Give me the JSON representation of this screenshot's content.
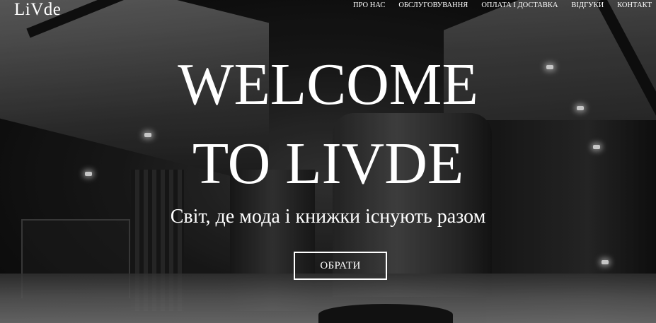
{
  "header": {
    "logo": "LiVde",
    "nav": [
      {
        "label": "ПРО НАС"
      },
      {
        "label": "ОБСЛУГОВУВАННЯ"
      },
      {
        "label": "ОПЛАТА І ДОСТАВКА"
      },
      {
        "label": "ВІДГУКИ"
      },
      {
        "label": "КОНТАКТ"
      }
    ]
  },
  "hero": {
    "title_line1": "WELCOME",
    "title_line2": "TO LIVDE",
    "subtitle": "Світ, де мода і книжки існують разом",
    "cta_label": "ОБРАТИ"
  },
  "colors": {
    "text": "#ffffff",
    "background": "#0b0b0b"
  }
}
